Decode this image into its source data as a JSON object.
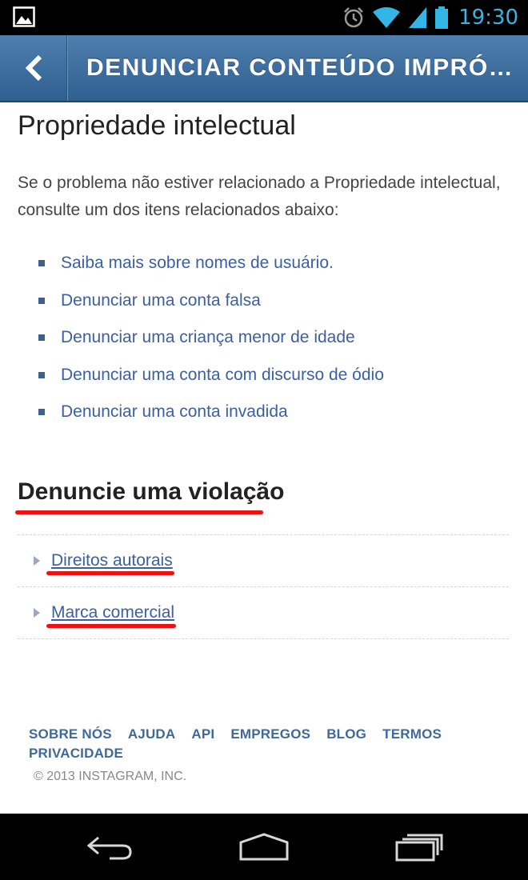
{
  "status_bar": {
    "time": "19:30",
    "icons": [
      "gallery-icon",
      "alarm-icon",
      "wifi-icon",
      "signal-icon",
      "battery-icon"
    ]
  },
  "header": {
    "back_icon": "chevron-left-icon",
    "title": "DENUNCIAR CONTEÚDO IMPRÓPRIO"
  },
  "content": {
    "title": "Propriedade intelectual",
    "intro": "Se o problema não estiver relacionado a Propriedade intelectual, consulte um dos itens relacionados abaixo:",
    "related_links": [
      "Saiba mais sobre nomes de usuário.",
      "Denunciar uma conta falsa",
      "Denunciar uma criança menor de idade",
      "Denunciar uma conta com discurso de ódio",
      "Denunciar uma conta invadida"
    ],
    "violation_section": {
      "title": "Denuncie uma violação",
      "items": [
        "Direitos autorais",
        "Marca comercial"
      ]
    }
  },
  "footer": {
    "links": [
      "SOBRE NÓS",
      "AJUDA",
      "API",
      "EMPREGOS",
      "BLOG",
      "TERMOS",
      "PRIVACIDADE"
    ],
    "copyright": "© 2013 INSTAGRAM, INC."
  },
  "colors": {
    "header_bg": "#3a6a9a",
    "link": "#3b5fa0",
    "annotation_red": "#ee1111",
    "status_time": "#33b5e5"
  },
  "nav_bar": {
    "icons": [
      "back-arrow-icon",
      "home-icon",
      "recent-apps-icon"
    ]
  }
}
